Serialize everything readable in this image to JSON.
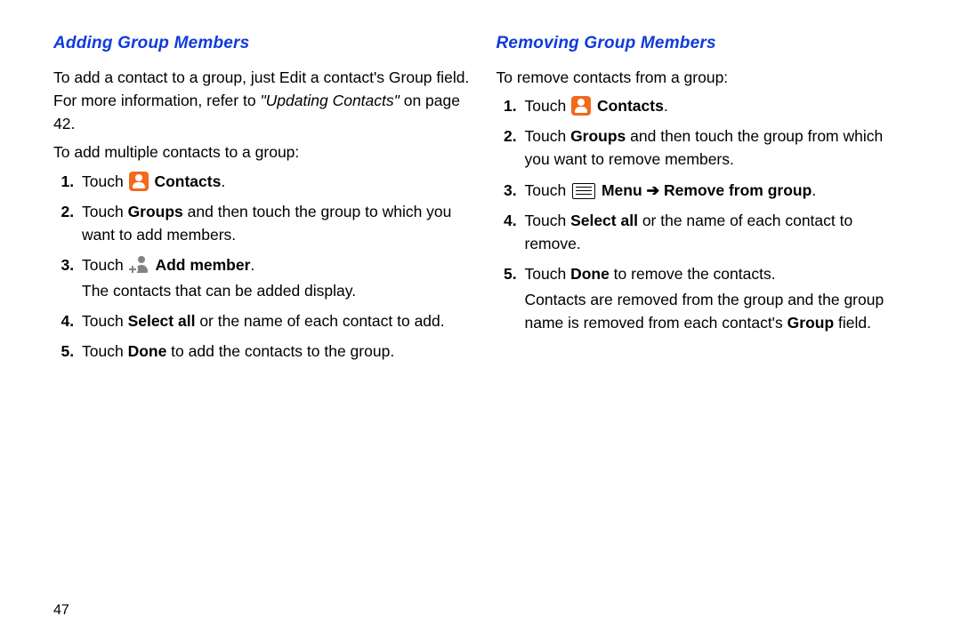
{
  "page_number": "47",
  "left": {
    "heading": "Adding Group Members",
    "intro_1a": "To add a contact to a group, just Edit a contact's Group field. For more information, refer to ",
    "intro_ref": "\"Updating Contacts\"",
    "intro_1b": " on page 42.",
    "intro_2": "To add multiple contacts to a group:",
    "steps": {
      "s1_a": "Touch ",
      "s1_b": "Contacts",
      "s1_c": ".",
      "s2_a": "Touch ",
      "s2_b": "Groups",
      "s2_c": " and then touch the group to which you want to add members.",
      "s3_a": "Touch ",
      "s3_b": "Add member",
      "s3_c": ".",
      "s3_sub": "The contacts that can be added display.",
      "s4_a": "Touch ",
      "s4_b": "Select all",
      "s4_c": " or the name of each contact to add.",
      "s5_a": "Touch ",
      "s5_b": "Done",
      "s5_c": " to add the contacts to the group."
    }
  },
  "right": {
    "heading": "Removing Group Members",
    "intro": "To remove contacts from a group:",
    "steps": {
      "s1_a": "Touch ",
      "s1_b": "Contacts",
      "s1_c": ".",
      "s2_a": "Touch ",
      "s2_b": "Groups",
      "s2_c": " and then touch the group from which you want to remove members.",
      "s3_a": "Touch ",
      "s3_b": "Menu",
      "s3_arrow": " ➔ ",
      "s3_c": "Remove from group",
      "s3_d": ".",
      "s4_a": "Touch ",
      "s4_b": "Select all",
      "s4_c": " or the name of each contact to remove.",
      "s5_a": "Touch ",
      "s5_b": "Done",
      "s5_c": " to remove the contacts.",
      "s5_sub_a": "Contacts are removed from the group and the group name is removed from each contact's ",
      "s5_sub_b": "Group",
      "s5_sub_c": " field."
    }
  }
}
